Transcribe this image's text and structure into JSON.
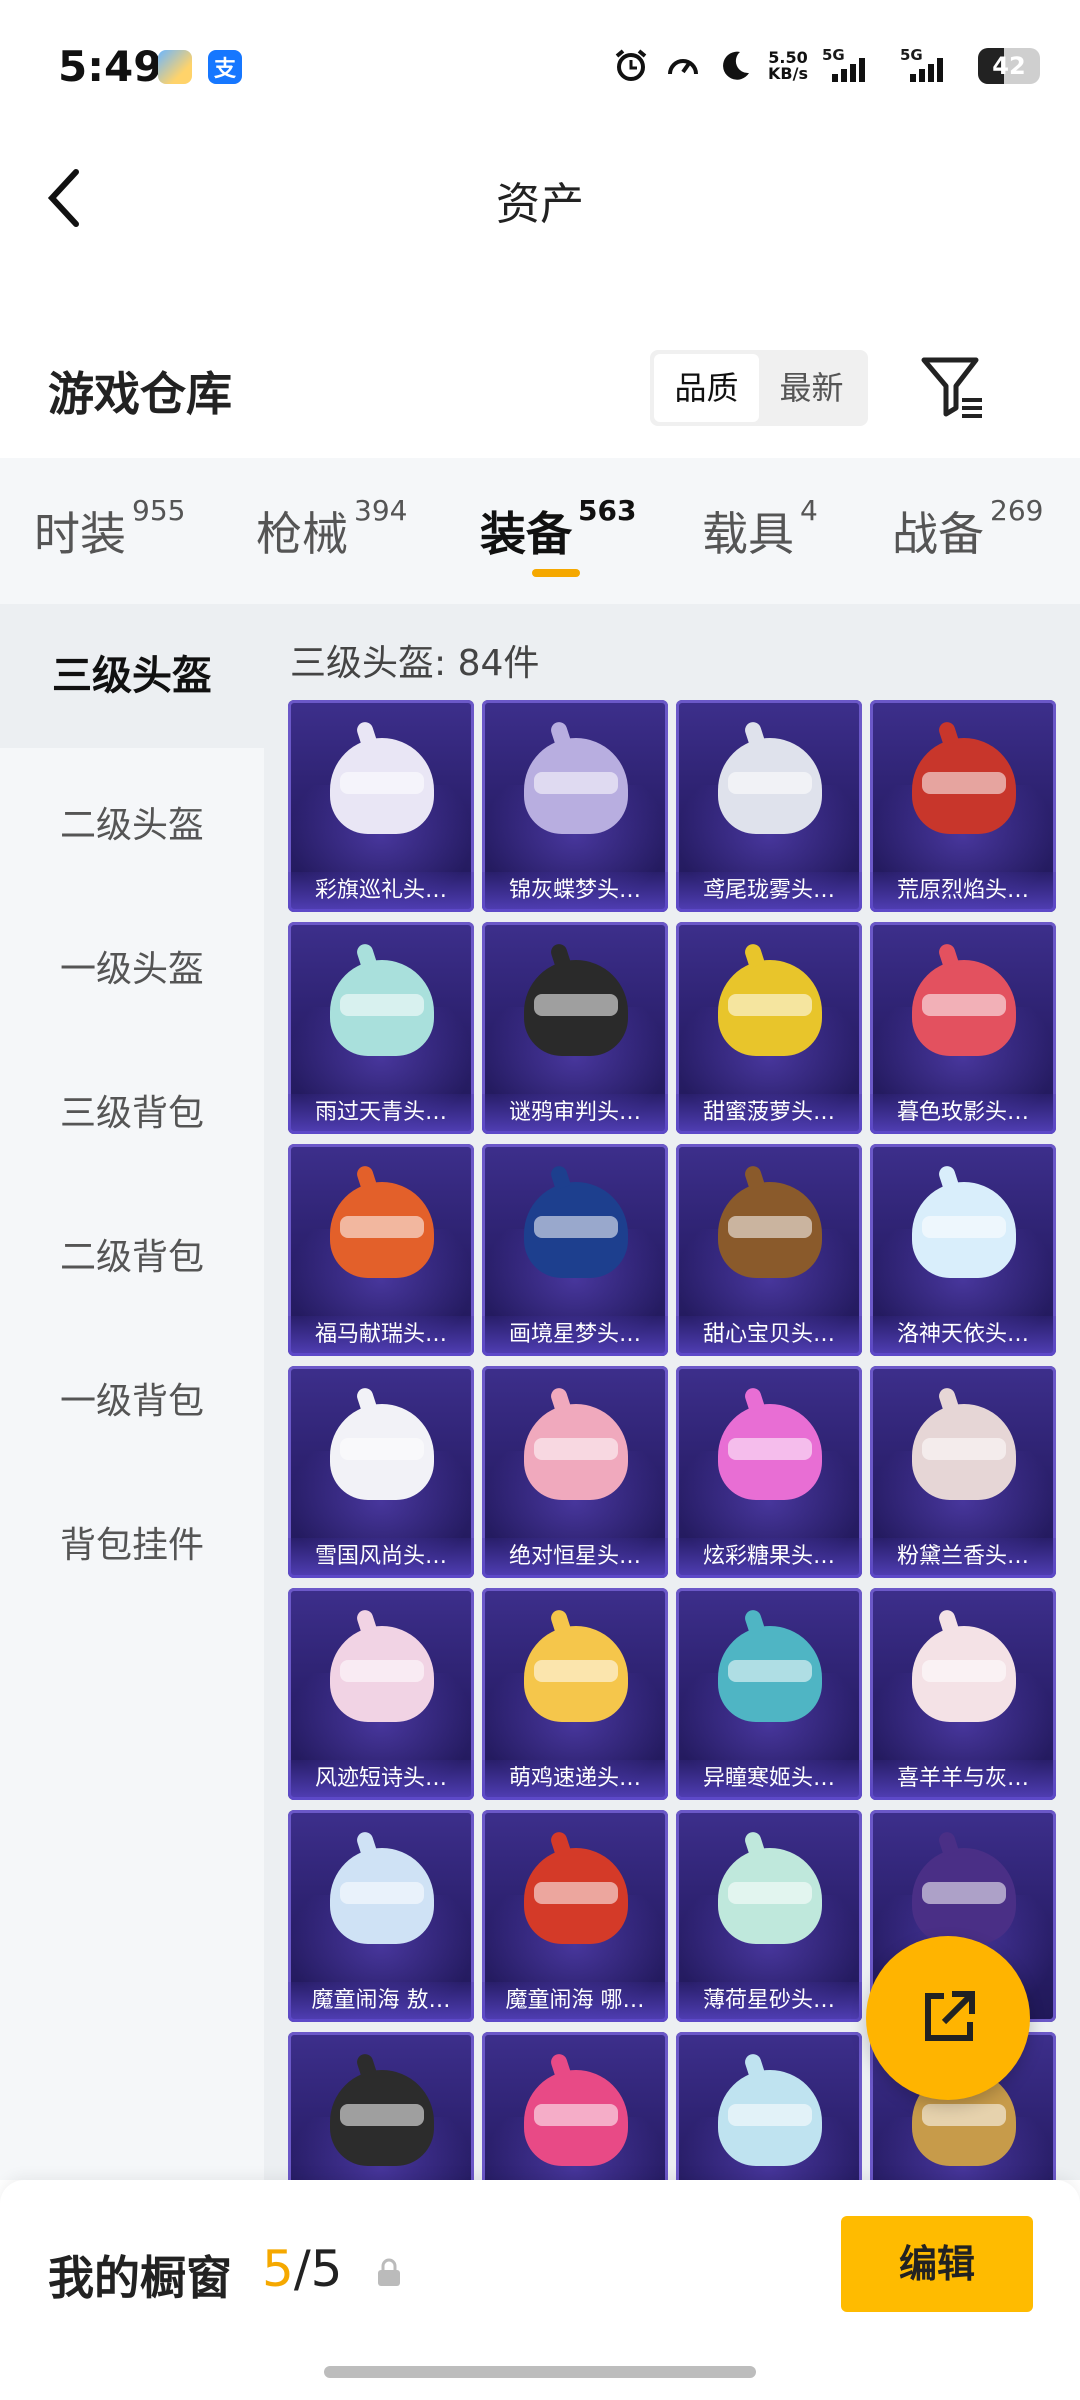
{
  "status_bar": {
    "time": "5:49",
    "network_speed_value": "5.50",
    "network_speed_unit": "KB/s",
    "sim1_label": "5G",
    "sim2_label": "5G",
    "battery_level": "42",
    "app_icon_2_glyph": "支"
  },
  "header": {
    "title": "资产"
  },
  "warehouse": {
    "title": "游戏仓库",
    "sort": {
      "options": [
        "品质",
        "最新"
      ],
      "selected": "品质"
    }
  },
  "tabs": [
    {
      "label": "时装",
      "count": "955"
    },
    {
      "label": "枪械",
      "count": "394"
    },
    {
      "label": "装备",
      "count": "563",
      "active": true
    },
    {
      "label": "载具",
      "count": "4"
    },
    {
      "label": "战备",
      "count": "269"
    }
  ],
  "sidebar": {
    "items": [
      {
        "label": "三级头盔",
        "active": true
      },
      {
        "label": "二级头盔"
      },
      {
        "label": "一级头盔"
      },
      {
        "label": "三级背包"
      },
      {
        "label": "二级背包"
      },
      {
        "label": "一级背包"
      },
      {
        "label": "背包挂件"
      }
    ]
  },
  "content": {
    "count_label": "三级头盔: 84件",
    "items": [
      {
        "name": "彩旗巡礼头…",
        "color": "#e9e6f5"
      },
      {
        "name": "锦灰蝶梦头…",
        "color": "#b8aee0"
      },
      {
        "name": "鸢尾珑雾头…",
        "color": "#dfe2ec"
      },
      {
        "name": "荒原烈焰头…",
        "color": "#c8362b"
      },
      {
        "name": "雨过天青头…",
        "color": "#a9e0dc"
      },
      {
        "name": "谜鸦审判头…",
        "color": "#2a2a2a"
      },
      {
        "name": "甜蜜菠萝头…",
        "color": "#e8c52b"
      },
      {
        "name": "暮色玫影头…",
        "color": "#e3515f"
      },
      {
        "name": "福马献瑞头…",
        "color": "#e3602a"
      },
      {
        "name": "画境星梦头…",
        "color": "#1d3f8e"
      },
      {
        "name": "甜心宝贝头…",
        "color": "#8a5a2b"
      },
      {
        "name": "洛神天依头…",
        "color": "#d9eefb"
      },
      {
        "name": "雪国风尚头…",
        "color": "#f2f2f7"
      },
      {
        "name": "绝对恒星头…",
        "color": "#f0a9bd"
      },
      {
        "name": "炫彩糖果头…",
        "color": "#e86ed4"
      },
      {
        "name": "粉黛兰香头…",
        "color": "#e6d6d6"
      },
      {
        "name": "风迹短诗头…",
        "color": "#f1d3e4"
      },
      {
        "name": "萌鸡速递头…",
        "color": "#f5c64b"
      },
      {
        "name": "异瞳寒姬头…",
        "color": "#4fb5c4"
      },
      {
        "name": "喜羊羊与灰…",
        "color": "#f4e2e6"
      },
      {
        "name": "魔童闹海 敖…",
        "color": "#cfe2f5"
      },
      {
        "name": "魔童闹海 哪…",
        "color": "#d43a28"
      },
      {
        "name": "薄荷星砂头…",
        "color": "#bfe8dc"
      },
      {
        "name": "",
        "color": "#4a2f86"
      },
      {
        "name": "",
        "color": "#2c2c2c"
      },
      {
        "name": "",
        "color": "#e84a86"
      },
      {
        "name": "",
        "color": "#bfe3f0"
      },
      {
        "name": "",
        "color": "#c79b4a"
      }
    ]
  },
  "fab": {
    "icon": "external-share-icon"
  },
  "bottom_bar": {
    "label": "我的橱窗",
    "current": "5",
    "separator": "/",
    "total": "5",
    "edit_label": "编辑"
  },
  "colors": {
    "accent": "#f5a800",
    "edit_button": "#ffbb00",
    "card_bg": "#2a1f6b"
  }
}
